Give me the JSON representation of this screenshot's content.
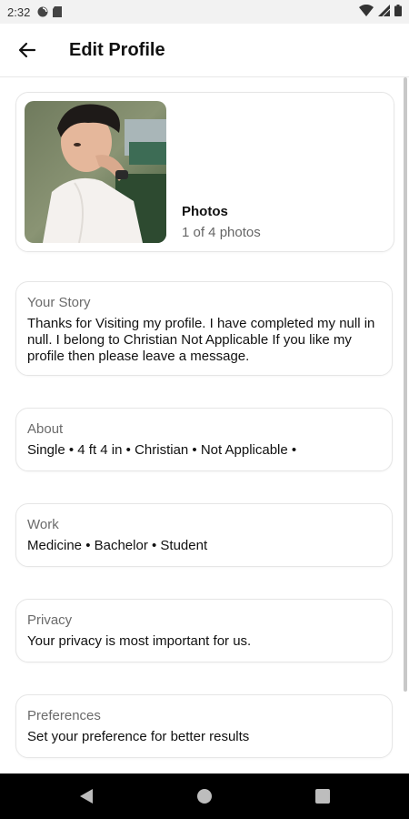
{
  "status_bar": {
    "time": "2:32"
  },
  "app_bar": {
    "title": "Edit Profile"
  },
  "photos": {
    "title": "Photos",
    "count": "1 of 4 photos"
  },
  "story": {
    "title": "Your Story",
    "text": "Thanks for Visiting my profile. I have completed my null in null. I belong to Christian Not Applicable If you like my profile then please leave a message."
  },
  "about": {
    "title": "About",
    "text": "Single • 4 ft 4 in • Christian • Not Applicable •"
  },
  "work": {
    "title": "Work",
    "text": "Medicine • Bachelor • Student"
  },
  "privacy": {
    "title": "Privacy",
    "text": "Your privacy is most important for us."
  },
  "preferences": {
    "title": "Preferences",
    "text": "Set your preference for better results"
  },
  "icons": {
    "back": "arrow-back-icon",
    "nav_back": "triangle-back-icon",
    "nav_home": "circle-home-icon",
    "nav_recents": "square-recents-icon"
  }
}
